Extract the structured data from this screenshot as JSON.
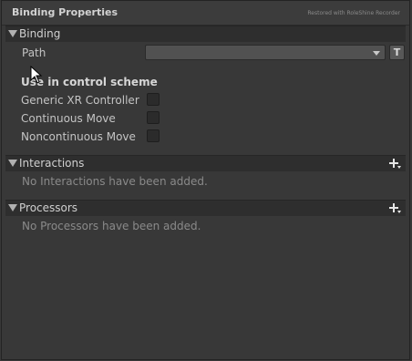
{
  "title": "Binding Properties",
  "subtitle": "Restored with RoleShine Recorder",
  "binding": {
    "section_label": "Binding",
    "path_label": "Path",
    "path_value": "",
    "t_button_label": "T",
    "scheme_heading": "Use in control scheme",
    "schemes": [
      {
        "label": "Generic XR Controller",
        "checked": false
      },
      {
        "label": "Continuous Move",
        "checked": false
      },
      {
        "label": "Noncontinuous Move",
        "checked": false
      }
    ]
  },
  "interactions": {
    "section_label": "Interactions",
    "empty_message": "No Interactions have been added."
  },
  "processors": {
    "section_label": "Processors",
    "empty_message": "No Processors have been added."
  },
  "icons": [
    "triangle-down-icon",
    "dropdown-arrow-icon",
    "add-icon",
    "mouse-cursor-icon"
  ]
}
